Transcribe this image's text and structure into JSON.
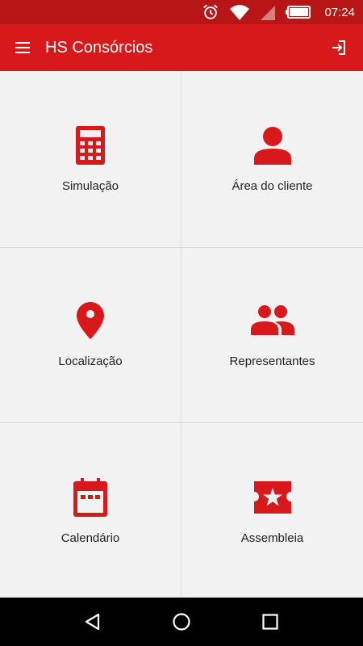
{
  "status_bar": {
    "time": "07:24",
    "icons": [
      "alarm-icon",
      "wifi-icon",
      "signal-icon",
      "battery-icon"
    ]
  },
  "app_bar": {
    "title": "HS Consórcios",
    "menu_icon": "menu-icon",
    "exit_icon": "exit-icon"
  },
  "tiles": [
    {
      "label": "Simulação",
      "icon": "calculator-icon"
    },
    {
      "label": "Área do cliente",
      "icon": "person-icon"
    },
    {
      "label": "Localização",
      "icon": "location-pin-icon"
    },
    {
      "label": "Representantes",
      "icon": "group-icon"
    },
    {
      "label": "Calendário",
      "icon": "calendar-icon"
    },
    {
      "label": "Assembleia",
      "icon": "ticket-star-icon"
    }
  ],
  "nav_bar": {
    "buttons": [
      "back-icon",
      "home-icon",
      "recents-icon"
    ]
  },
  "colors": {
    "accent": "#d7191c",
    "status_bar": "#b71516",
    "background": "#f2f2f2",
    "text": "#222222"
  }
}
